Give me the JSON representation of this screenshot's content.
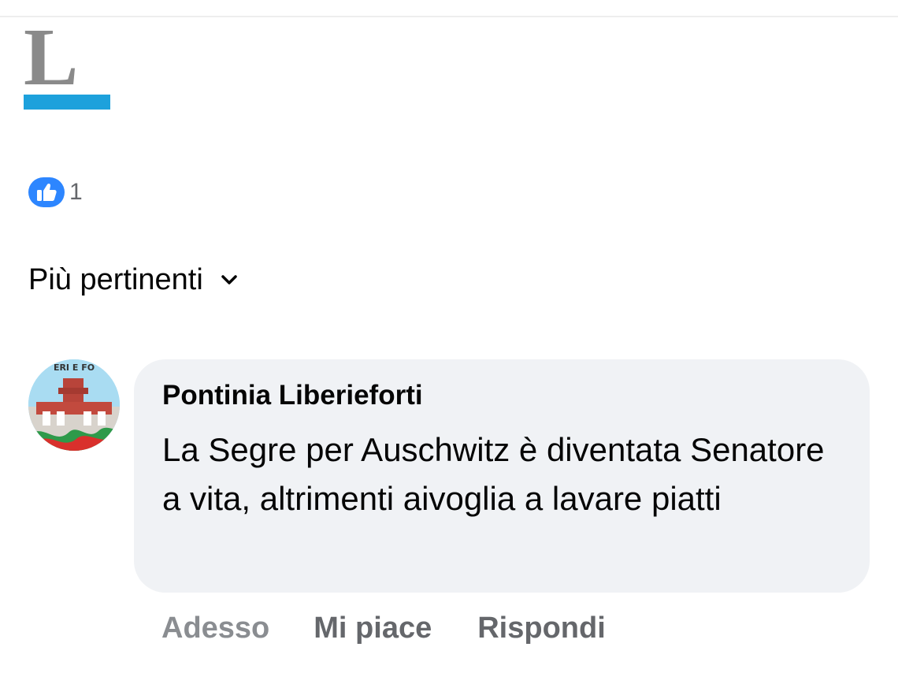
{
  "publisher": {
    "logo_letter": "L",
    "accent_color": "#1da1dc",
    "letter_color": "#8a8a8a"
  },
  "reactions": {
    "icon": "like-icon",
    "icon_color": "#2d86ff",
    "count": "1"
  },
  "sort": {
    "label": "Più pertinenti",
    "icon": "chevron-down-icon"
  },
  "comment": {
    "author": "Pontinia Liberieforti",
    "text": "La Segre per Auschwitz è diventata Senatore a vita, altrimenti aivoglia a lavare piatti",
    "avatar": {
      "icon": "avatar-image",
      "badge_text": "ERI E FO"
    },
    "bubble_color": "#f0f2f5",
    "actions": {
      "time": "Adesso",
      "like": "Mi piace",
      "reply": "Rispondi"
    }
  }
}
